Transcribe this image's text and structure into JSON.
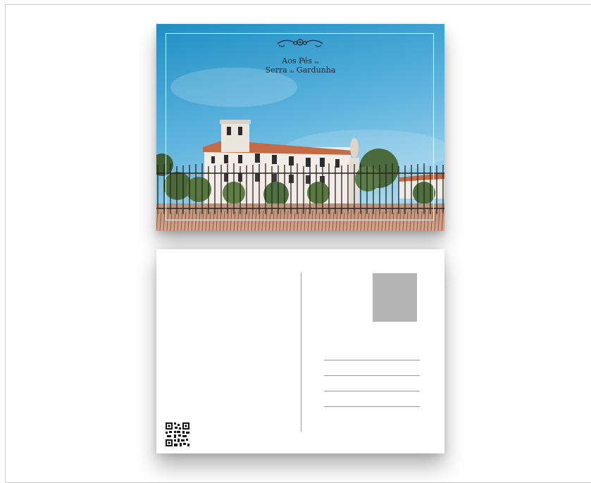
{
  "postcard_front": {
    "title_line1": "Aos Pés",
    "title_small1": "da",
    "title_line2_a": "Serra",
    "title_small2": "da",
    "title_line2_b": "Gardunha",
    "ornament_icon": "flourish-ornament-icon",
    "sky_color_top": "#1f8fc4",
    "sky_color_bottom": "#8dcbe8"
  },
  "postcard_back": {
    "stamp_color": "#b4b4b4",
    "address_lines": 4,
    "qr_icon": "qr-code-icon"
  }
}
